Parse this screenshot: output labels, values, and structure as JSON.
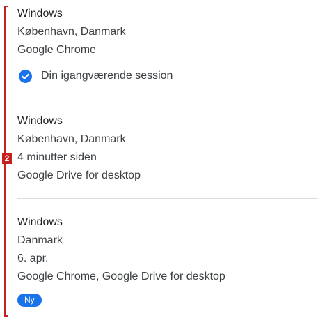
{
  "annotation": {
    "marker_label": "2",
    "accent_color": "#c5221f"
  },
  "sessions": [
    {
      "device": "Windows",
      "location": "København, Danmark",
      "time": "",
      "apps": "Google Chrome",
      "current_label": "Din igangværende session",
      "badge": ""
    },
    {
      "device": "Windows",
      "location": "København, Danmark",
      "time": "4 minutter siden",
      "apps": "Google Drive for desktop",
      "current_label": "",
      "badge": ""
    },
    {
      "device": "Windows",
      "location": "Danmark",
      "time": "6. apr.",
      "apps": "Google Chrome, Google Drive for desktop",
      "current_label": "",
      "badge": "Ny"
    }
  ],
  "icons": {
    "current_session": "check-circle-icon"
  },
  "colors": {
    "primary_blue": "#1a73e8",
    "divider": "#dadce0"
  }
}
